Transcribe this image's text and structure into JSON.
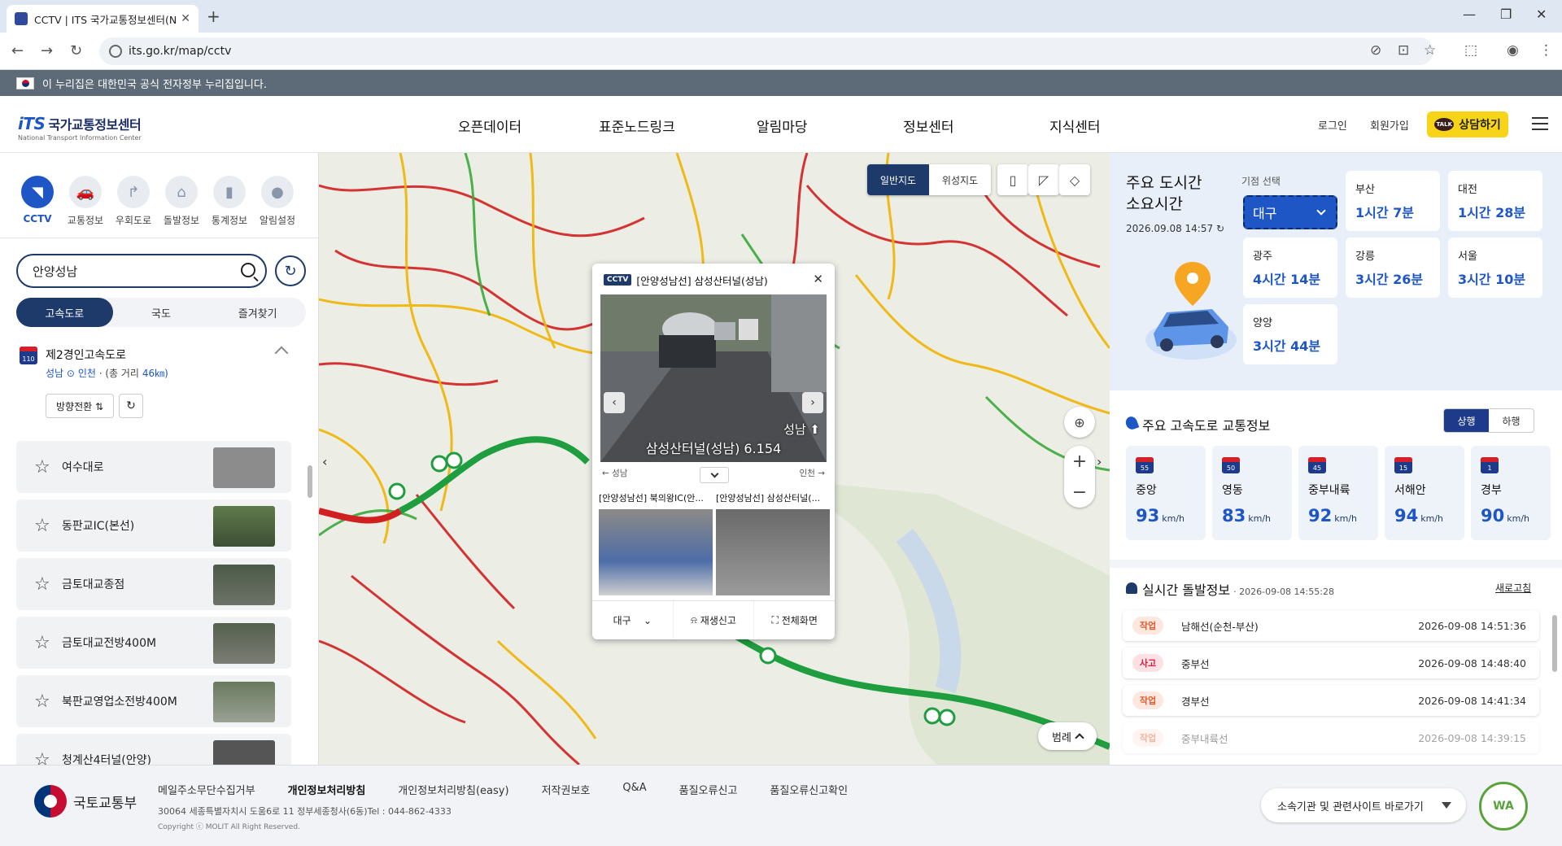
{
  "browser": {
    "tab_title": "CCTV | ITS 국가교통정보센터(N",
    "url": "its.go.kr/map/cctv"
  },
  "gov_banner": "이 누리집은 대한민국 공식 전자정부 누리집입니다.",
  "header": {
    "logo_main": "국가교통정보센터",
    "logo_its": "iTS",
    "logo_sub": "National Transport Information Center",
    "nav": [
      "오픈데이터",
      "표준노드링크",
      "알림마당",
      "정보센터",
      "지식센터"
    ],
    "login": "로그인",
    "signup": "회원가입",
    "talk_label": "상담하기",
    "talk_badge": "TALK"
  },
  "left": {
    "categories": [
      {
        "label": "CCTV",
        "icon": "cctv-icon"
      },
      {
        "label": "교통정보",
        "icon": "car-icon"
      },
      {
        "label": "우회도로",
        "icon": "detour-icon"
      },
      {
        "label": "돌발정보",
        "icon": "incident-icon"
      },
      {
        "label": "통계정보",
        "icon": "stats-icon"
      },
      {
        "label": "알림설정",
        "icon": "pin-icon"
      }
    ],
    "search_value": "안양성남",
    "tabs": [
      "고속도로",
      "국도",
      "즐겨찾기"
    ],
    "road": {
      "number": "110",
      "name": "제2경인고속도로",
      "from": "성남",
      "to": "인천",
      "distance_text": "(총 거리",
      "distance": "46㎞)",
      "dir_button": "방향전환 ⇅"
    },
    "cctv_list": [
      "여수대로",
      "동판교IC(본선)",
      "금토대교종점",
      "금토대교전방400M",
      "북판교영업소전방400M",
      "청계산4터널(안양)"
    ]
  },
  "map": {
    "type_normal": "일반지도",
    "type_satellite": "위성지도",
    "legend": "범례",
    "popup": {
      "badge": "CCTV",
      "title": "[안양성남선] 삼성산터널(성남)",
      "caption": "삼성산터널(성남) 6.154",
      "dest": "성남 ⬆",
      "dir_left": "← 성남",
      "dir_right": "인천 →",
      "sub1": "[안양성남선] 북의왕IC(안...",
      "sub2": "[안양성남선] 삼성산터널(...",
      "region": "대구",
      "report": "재생신고",
      "fullscreen": "전체화면"
    }
  },
  "right": {
    "city_title_1": "주요 도시간",
    "city_title_2": "소요시간",
    "city_time": "2026.09.08 14:57",
    "base_label": "기점 선택",
    "base_value": "대구",
    "cities": [
      {
        "name": "부산",
        "time": "1시간 7분"
      },
      {
        "name": "대전",
        "time": "1시간 28분"
      },
      {
        "name": "광주",
        "time": "4시간 14분"
      },
      {
        "name": "강릉",
        "time": "3시간 26분"
      },
      {
        "name": "서울",
        "time": "3시간 10분"
      },
      {
        "name": "양양",
        "time": "3시간 44분"
      }
    ],
    "hwy_title": "주요 고속도로 교통정보",
    "dir_up": "상행",
    "dir_down": "하행",
    "highways": [
      {
        "no": "55",
        "name": "중앙",
        "speed": "93"
      },
      {
        "no": "50",
        "name": "영동",
        "speed": "83"
      },
      {
        "no": "45",
        "name": "중부내륙",
        "speed": "92"
      },
      {
        "no": "15",
        "name": "서해안",
        "speed": "94"
      },
      {
        "no": "1",
        "name": "경부",
        "speed": "90"
      }
    ],
    "speed_unit": "km/h",
    "inc_title": "실시간 돌발정보",
    "inc_time": "· 2026-09-08  14:55:28",
    "inc_refresh": "새로고침",
    "incidents": [
      {
        "tag": "작업",
        "road": "남해선(순천-부산)",
        "time": "2026-09-08  14:51:36"
      },
      {
        "tag": "사고",
        "road": "중부선",
        "time": "2026-09-08  14:48:40"
      },
      {
        "tag": "작업",
        "road": "경부선",
        "time": "2026-09-08  14:41:34"
      },
      {
        "tag": "작업",
        "road": "중부내륙선",
        "time": "2026-09-08  14:39:15"
      }
    ]
  },
  "footer": {
    "org": "국토교통부",
    "links": [
      "메일주소무단수집거부",
      "개인정보처리방침",
      "개인정보처리방침(easy)",
      "저작권보호",
      "Q&A",
      "품질오류신고",
      "품질오류신고확인"
    ],
    "address": "30064  세종특별자치시 도움6로 11 정부세종청사(6동)Tel : 044-862-4333",
    "copyright": "Copyright ⓒ MOLIT All Right Reserved.",
    "related": "소속기관 및 관련사이트 바로가기"
  }
}
